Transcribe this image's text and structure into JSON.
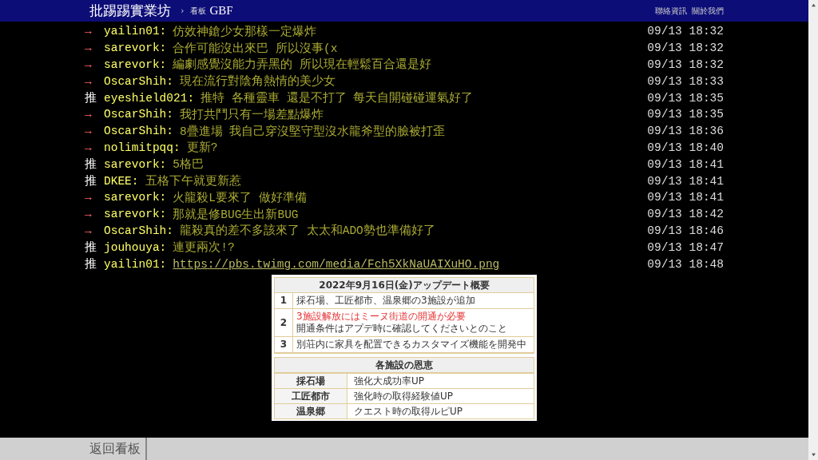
{
  "header": {
    "site": "批踢踢實業坊",
    "separator": "›",
    "board_label": "看板",
    "board": "GBF",
    "links": [
      "聯絡資訊",
      "關於我們"
    ]
  },
  "pushes": [
    {
      "kind": "arrow",
      "tag": "→",
      "user": "yailin01:",
      "content": "仿效神鎗少女那樣一定爆炸",
      "time": "09/13 18:32"
    },
    {
      "kind": "arrow",
      "tag": "→",
      "user": "sarevork:",
      "content": "合作可能沒出來巴 所以沒事(x",
      "time": "09/13 18:32"
    },
    {
      "kind": "arrow",
      "tag": "→",
      "user": "sarevork:",
      "content": "編劇感覺沒能力弄黑的 所以現在輕鬆百合還是好",
      "time": "09/13 18:32"
    },
    {
      "kind": "arrow",
      "tag": "→",
      "user": "OscarShih:",
      "content": "現在流行對陰角熱情的美少女",
      "time": "09/13 18:33"
    },
    {
      "kind": "push",
      "tag": "推",
      "user": "eyeshield021:",
      "content": "推特 各種靈車 還是不打了 每天自開碰碰運氣好了",
      "time": "09/13 18:35"
    },
    {
      "kind": "arrow",
      "tag": "→",
      "user": "OscarShih:",
      "content": "我打共鬥只有一場差點爆炸",
      "time": "09/13 18:35"
    },
    {
      "kind": "arrow",
      "tag": "→",
      "user": "OscarShih:",
      "content": "8疊進場 我自己穿沒堅守型沒水龍斧型的臉被打歪",
      "time": "09/13 18:36"
    },
    {
      "kind": "arrow",
      "tag": "→",
      "user": "nolimitpqq:",
      "content": "更新?",
      "time": "09/13 18:40"
    },
    {
      "kind": "push",
      "tag": "推",
      "user": "sarevork:",
      "content": "5格巴",
      "time": "09/13 18:41"
    },
    {
      "kind": "push",
      "tag": "推",
      "user": "DKEE:",
      "content": "五格下午就更新惹",
      "time": "09/13 18:41"
    },
    {
      "kind": "arrow",
      "tag": "→",
      "user": "sarevork:",
      "content": "火龍殺L要來了 做好準備",
      "time": "09/13 18:41"
    },
    {
      "kind": "arrow",
      "tag": "→",
      "user": "sarevork:",
      "content": "那就是修BUG生出新BUG",
      "time": "09/13 18:42"
    },
    {
      "kind": "arrow",
      "tag": "→",
      "user": "OscarShih:",
      "content": "龍殺真的差不多該來了 太太和ADO勢也準備好了",
      "time": "09/13 18:46"
    },
    {
      "kind": "push",
      "tag": "推",
      "user": "jouhouya:",
      "content": "連更兩次!?",
      "time": "09/13 18:47"
    },
    {
      "kind": "push",
      "tag": "推",
      "user": "yailin01:",
      "link": "https://pbs.twimg.com/media/Fch5XkNaUAIXuHO.png",
      "time": "09/13 18:48"
    }
  ],
  "embedded_image": {
    "summary_title": "2022年9月16日(金)アップデート概要",
    "summary_rows": [
      {
        "number": "1",
        "lines": [
          {
            "text": "採石場、工匠都市、温泉郷の3施設が追加",
            "highlight": false
          }
        ]
      },
      {
        "number": "2",
        "lines": [
          {
            "text": "3施設解放にはミーヌ街道の開通が必要",
            "highlight": true
          },
          {
            "text": "開通条件はアプデ時に確認してくださいとのこと",
            "highlight": false
          }
        ]
      },
      {
        "number": "3",
        "lines": [
          {
            "text": "別荘内に家具を配置できるカスタマイズ機能を開発中",
            "highlight": false
          }
        ]
      }
    ],
    "benefits_title": "各施設の恩恵",
    "benefit_rows": [
      {
        "facility": "採石場",
        "benefit": "強化大成功率UP"
      },
      {
        "facility": "工匠都市",
        "benefit": "強化時の取得経験値UP"
      },
      {
        "facility": "温泉郷",
        "benefit": "クエスト時の取得ルピUP"
      }
    ]
  },
  "footer": {
    "back": "返回看板"
  }
}
